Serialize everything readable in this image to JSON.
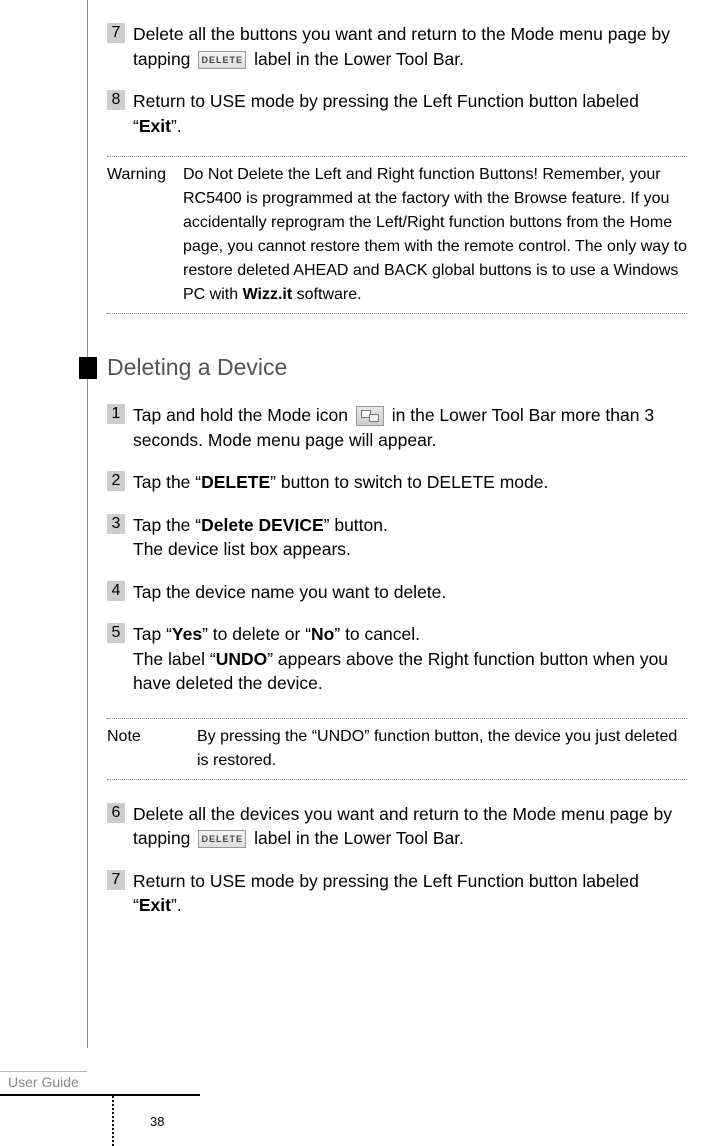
{
  "steps_a": {
    "s7": {
      "num": "7",
      "text_before": "Delete all the buttons you want and return to the Mode menu page by tapping ",
      "icon": "DELETE",
      "text_after": " label in the Lower Tool Bar."
    },
    "s8": {
      "num": "8",
      "text_before": "Return to USE mode by pressing the Left Function button labe­led “",
      "bold": "Exit",
      "text_after": "”."
    }
  },
  "warning": {
    "label": "Warning",
    "text_before": "Do Not Delete the Left and Right function Buttons! Remember, your RC5400 is programmed at the factory with the Browse feature. If you accidentally reprogram the Left/Right function but­tons from the Home page, you cannot restore them with the remote control. The only way to restore deleted AHEAD and BACK global buttons is to use a Windows PC with ",
    "bold": "Wizz.it",
    "text_after": " soft­ware."
  },
  "heading": "Deleting a Device",
  "steps_b": {
    "s1": {
      "num": "1",
      "text_before": "Tap and hold the Mode icon ",
      "text_after": " in the Lower Tool Bar more than 3 seconds. Mode menu page will appear."
    },
    "s2": {
      "num": "2",
      "t1": "Tap the “",
      "b1": "DELETE",
      "t2": "” button to switch to DELETE mode."
    },
    "s3": {
      "num": "3",
      "t1": "Tap the “",
      "b1": "Delete DEVICE",
      "t2": "” button.",
      "line2": "The device list box appears."
    },
    "s4": {
      "num": "4",
      "text": "Tap the device name you want to delete."
    },
    "s5": {
      "num": "5",
      "t1": "Tap “",
      "b1": "Yes",
      "t2": "” to delete or “",
      "b2": "No",
      "t3": "” to cancel.",
      "l2a": "The label “",
      "l2b": "UNDO",
      "l2c": "” appears above the Right function button when you have deleted the device."
    },
    "s6": {
      "num": "6",
      "text_before": "Delete all the devices you want and return to the Mode menu page by tapping ",
      "icon": "DELETE",
      "text_after": " label in the Lower Tool Bar."
    },
    "s7": {
      "num": "7",
      "text_before": "Return to USE mode by pressing the Left Function button labe­led “",
      "bold": "Exit",
      "text_after": "”."
    }
  },
  "note": {
    "label": "Note",
    "text": "By pressing the “UNDO” function button, the device you just deleted is restored."
  },
  "footer": {
    "guide": "User Guide",
    "page": "38"
  }
}
